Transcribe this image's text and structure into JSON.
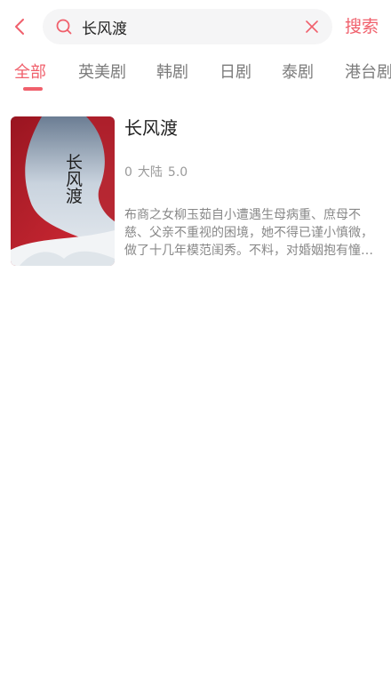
{
  "search": {
    "query": "长风渡",
    "submit_label": "搜索"
  },
  "tabs": [
    {
      "label": "全部",
      "active": true
    },
    {
      "label": "英美剧",
      "active": false
    },
    {
      "label": "韩剧",
      "active": false
    },
    {
      "label": "日剧",
      "active": false
    },
    {
      "label": "泰剧",
      "active": false
    },
    {
      "label": "港台剧",
      "active": false
    }
  ],
  "results": [
    {
      "title": "长风渡",
      "poster_text": "长风渡",
      "count": "0",
      "region": "大陆",
      "rating": "5.0",
      "description": "布商之女柳玉茹自小遭遇生母病重、庶母不慈、父亲不重视的困境，她不得已谨小慎微，做了十几年模范闺秀。不料，对婚姻抱有憧憬的她却被家里安排嫁给了名满扬州的纨绔子弟顾九思……"
    }
  ],
  "colors": {
    "accent": "#f0606c",
    "tab_inactive": "#7c7c7c",
    "search_bg": "#f5f5f6"
  },
  "icons": {
    "back": "chevron-left-icon",
    "search": "search-icon",
    "clear": "close-icon"
  }
}
